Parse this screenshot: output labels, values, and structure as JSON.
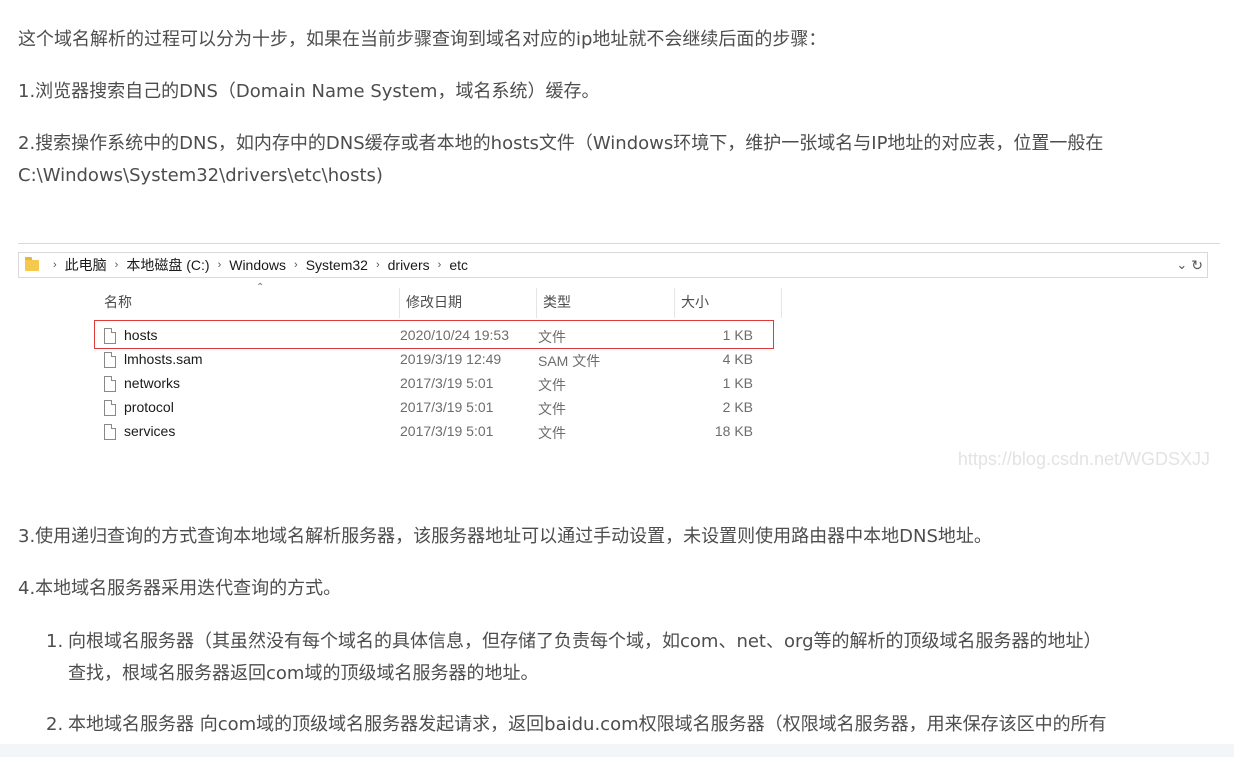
{
  "article": {
    "intro": "这个域名解析的过程可以分为十步，如果在当前步骤查询到域名对应的ip地址就不会继续后面的步骤：",
    "step1": "1.浏览器搜索自己的DNS（Domain Name System，域名系统）缓存。",
    "step2_line1": "2.搜索操作系统中的DNS，如内存中的DNS缓存或者本地的hosts文件（Windows环境下，维护一张域名与IP地址的对应表，位置一般在",
    "step2_line2": "C:\\Windows\\System32\\drivers\\etc\\hosts)",
    "step3": "3.使用递归查询的方式查询本地域名解析服务器，该服务器地址可以通过手动设置，未设置则使用路由器中本地DNS地址。",
    "step4": "4.本地域名服务器采用迭代查询的方式。",
    "sub1_num": "1.",
    "sub1_line1": "向根域名服务器（其虽然没有每个域名的具体信息，但存储了负责每个域，如com、net、org等的解析的顶级域名服务器的地址）",
    "sub1_line2": "查找，根域名服务器返回com域的顶级域名服务器的地址。",
    "sub2_num": "2.",
    "sub2_line1": "本地域名服务器 向com域的顶级域名服务器发起请求，返回baidu.com权限域名服务器（权限域名服务器，用来保存该区中的所有"
  },
  "explorer": {
    "breadcrumb": [
      "此电脑",
      "本地磁盘 (C:)",
      "Windows",
      "System32",
      "drivers",
      "etc"
    ],
    "columns": {
      "name": "名称",
      "modified": "修改日期",
      "type": "类型",
      "size": "大小"
    },
    "files": [
      {
        "name": "hosts",
        "modified": "2020/10/24 19:53",
        "type": "文件",
        "size": "1 KB",
        "highlighted": true
      },
      {
        "name": "lmhosts.sam",
        "modified": "2019/3/19 12:49",
        "type": "SAM 文件",
        "size": "4 KB"
      },
      {
        "name": "networks",
        "modified": "2017/3/19 5:01",
        "type": "文件",
        "size": "1 KB"
      },
      {
        "name": "protocol",
        "modified": "2017/3/19 5:01",
        "type": "文件",
        "size": "2 KB"
      },
      {
        "name": "services",
        "modified": "2017/3/19 5:01",
        "type": "文件",
        "size": "18 KB"
      }
    ],
    "watermark": "https://blog.csdn.net/WGDSXJJ",
    "highlight_color": "#e03a3a"
  }
}
